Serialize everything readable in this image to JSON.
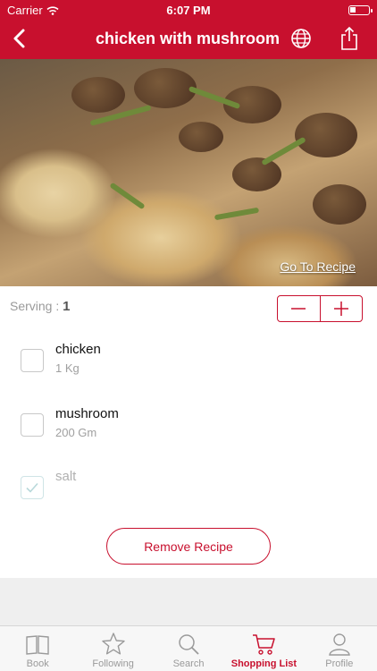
{
  "status_bar": {
    "carrier": "Carrier",
    "time": "6:07 PM"
  },
  "nav": {
    "title": "chicken with mushroom"
  },
  "hero": {
    "link_label": "Go To Recipe"
  },
  "serving": {
    "label": "Serving :",
    "value": "1"
  },
  "ingredients": [
    {
      "name": "chicken",
      "quantity": "1 Kg",
      "checked": false
    },
    {
      "name": "mushroom",
      "quantity": "200 Gm",
      "checked": false
    },
    {
      "name": "salt",
      "quantity": "",
      "checked": true
    }
  ],
  "remove_label": "Remove Recipe",
  "tabs": [
    {
      "label": "Book",
      "icon": "book-icon",
      "active": false
    },
    {
      "label": "Following",
      "icon": "star-icon",
      "active": false
    },
    {
      "label": "Search",
      "icon": "search-icon",
      "active": false
    },
    {
      "label": "Shopping List",
      "icon": "cart-icon",
      "active": true
    },
    {
      "label": "Profile",
      "icon": "person-icon",
      "active": false
    }
  ],
  "colors": {
    "accent": "#c8102e",
    "check_on": "#cfe4e6"
  }
}
